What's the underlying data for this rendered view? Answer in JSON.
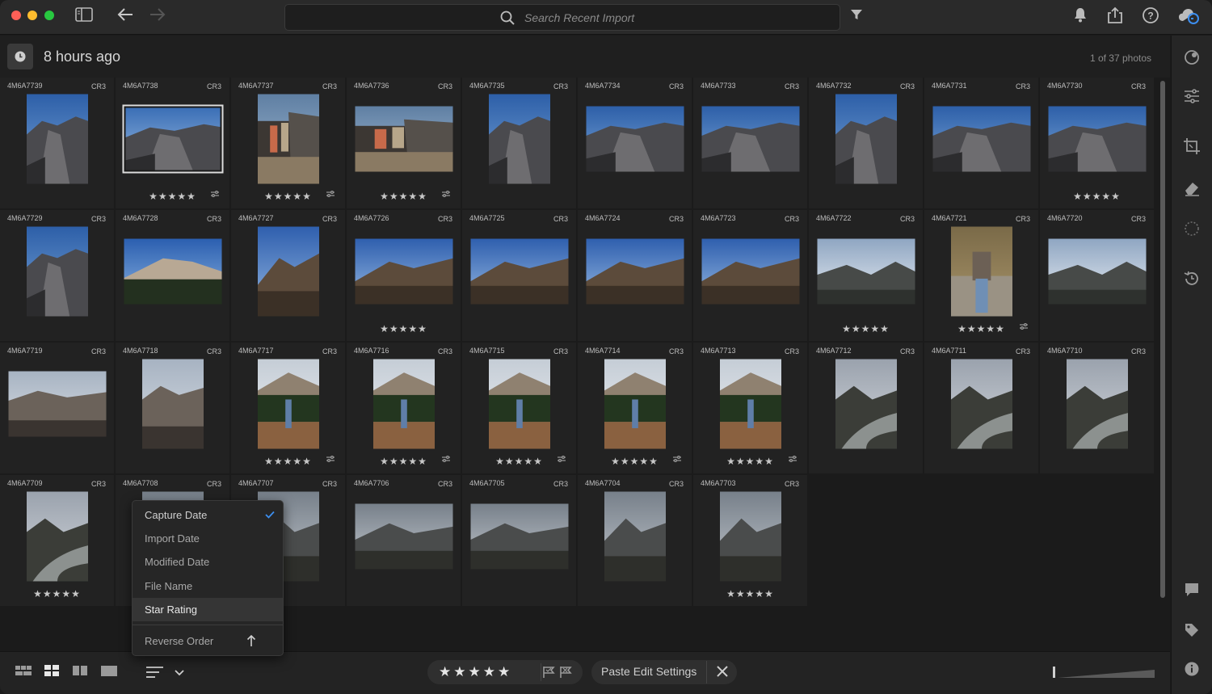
{
  "search": {
    "placeholder": "Search Recent Import"
  },
  "header": {
    "title": "8 hours ago",
    "count": "1 of 37 photos"
  },
  "grid": {
    "ext": "CR3",
    "rows": [
      [
        {
          "name": "4M6A7739",
          "o": "port",
          "scene": "canyon",
          "stars": false,
          "adj": false,
          "sel": false
        },
        {
          "name": "4M6A7738",
          "o": "land",
          "scene": "canyon2",
          "stars": true,
          "adj": true,
          "sel": true
        },
        {
          "name": "4M6A7737",
          "o": "port",
          "scene": "people",
          "stars": true,
          "adj": true,
          "sel": false
        },
        {
          "name": "4M6A7736",
          "o": "land",
          "scene": "people",
          "stars": true,
          "adj": true,
          "sel": false
        },
        {
          "name": "4M6A7735",
          "o": "port",
          "scene": "canyon",
          "stars": false,
          "adj": false,
          "sel": false
        },
        {
          "name": "4M6A7734",
          "o": "land",
          "scene": "canyon",
          "stars": false,
          "adj": false,
          "sel": false
        },
        {
          "name": "4M6A7733",
          "o": "land",
          "scene": "canyon",
          "stars": false,
          "adj": false,
          "sel": false
        },
        {
          "name": "4M6A7732",
          "o": "port",
          "scene": "canyon",
          "stars": false,
          "adj": false,
          "sel": false
        },
        {
          "name": "4M6A7731",
          "o": "land",
          "scene": "canyon",
          "stars": false,
          "adj": false,
          "sel": false
        },
        {
          "name": "4M6A7730",
          "o": "land",
          "scene": "canyon",
          "stars": true,
          "adj": false,
          "sel": false
        }
      ],
      [
        {
          "name": "4M6A7729",
          "o": "port",
          "scene": "canyon",
          "stars": false,
          "adj": false,
          "sel": false
        },
        {
          "name": "4M6A7728",
          "o": "land",
          "scene": "forest",
          "stars": false,
          "adj": false,
          "sel": false
        },
        {
          "name": "4M6A7727",
          "o": "port",
          "scene": "mountain",
          "stars": false,
          "adj": false,
          "sel": false
        },
        {
          "name": "4M6A7726",
          "o": "land",
          "scene": "mountain",
          "stars": true,
          "adj": false,
          "sel": false
        },
        {
          "name": "4M6A7725",
          "o": "land",
          "scene": "mountain",
          "stars": false,
          "adj": false,
          "sel": false
        },
        {
          "name": "4M6A7724",
          "o": "land",
          "scene": "mountain",
          "stars": false,
          "adj": false,
          "sel": false
        },
        {
          "name": "4M6A7723",
          "o": "land",
          "scene": "mountain",
          "stars": false,
          "adj": false,
          "sel": false
        },
        {
          "name": "4M6A7722",
          "o": "land",
          "scene": "cloudy",
          "stars": true,
          "adj": false,
          "sel": false
        },
        {
          "name": "4M6A7721",
          "o": "port",
          "scene": "photographer",
          "stars": true,
          "adj": true,
          "sel": false
        },
        {
          "name": "4M6A7720",
          "o": "land",
          "scene": "cloudy",
          "stars": false,
          "adj": false,
          "sel": false
        }
      ],
      [
        {
          "name": "4M6A7719",
          "o": "land",
          "scene": "hazy",
          "stars": false,
          "adj": false,
          "sel": false
        },
        {
          "name": "4M6A7718",
          "o": "port",
          "scene": "hazy",
          "stars": false,
          "adj": false,
          "sel": false
        },
        {
          "name": "4M6A7717",
          "o": "port",
          "scene": "person",
          "stars": true,
          "adj": true,
          "sel": false
        },
        {
          "name": "4M6A7716",
          "o": "port",
          "scene": "person",
          "stars": true,
          "adj": true,
          "sel": false
        },
        {
          "name": "4M6A7715",
          "o": "port",
          "scene": "person",
          "stars": true,
          "adj": true,
          "sel": false
        },
        {
          "name": "4M6A7714",
          "o": "port",
          "scene": "person",
          "stars": true,
          "adj": true,
          "sel": false
        },
        {
          "name": "4M6A7713",
          "o": "port",
          "scene": "person",
          "stars": true,
          "adj": true,
          "sel": false
        },
        {
          "name": "4M6A7712",
          "o": "port",
          "scene": "river",
          "stars": false,
          "adj": false,
          "sel": false
        },
        {
          "name": "4M6A7711",
          "o": "port",
          "scene": "river",
          "stars": false,
          "adj": false,
          "sel": false
        },
        {
          "name": "4M6A7710",
          "o": "port",
          "scene": "river",
          "stars": false,
          "adj": false,
          "sel": false
        }
      ],
      [
        {
          "name": "4M6A7709",
          "o": "port",
          "scene": "river",
          "stars": true,
          "adj": false,
          "sel": false
        },
        {
          "name": "4M6A7708",
          "o": "port",
          "scene": "stormy",
          "stars": false,
          "adj": false,
          "sel": false
        },
        {
          "name": "4M6A7707",
          "o": "port",
          "scene": "stormy",
          "stars": false,
          "adj": false,
          "sel": false
        },
        {
          "name": "4M6A7706",
          "o": "land",
          "scene": "stormy",
          "stars": false,
          "adj": false,
          "sel": false
        },
        {
          "name": "4M6A7705",
          "o": "land",
          "scene": "stormy",
          "stars": false,
          "adj": false,
          "sel": false
        },
        {
          "name": "4M6A7704",
          "o": "port",
          "scene": "stormy",
          "stars": false,
          "adj": false,
          "sel": false
        },
        {
          "name": "4M6A7703",
          "o": "port",
          "scene": "stormy",
          "stars": true,
          "adj": false,
          "sel": false
        }
      ]
    ]
  },
  "sort_menu": {
    "items": [
      "Capture Date",
      "Import Date",
      "Modified Date",
      "File Name",
      "Star Rating"
    ],
    "checked": "Capture Date",
    "highlighted": "Star Rating",
    "reverse": "Reverse Order"
  },
  "bottom": {
    "stars": "★",
    "paste_label": "Paste Edit Settings"
  },
  "colors": {
    "accent": "#3d8ff0"
  }
}
